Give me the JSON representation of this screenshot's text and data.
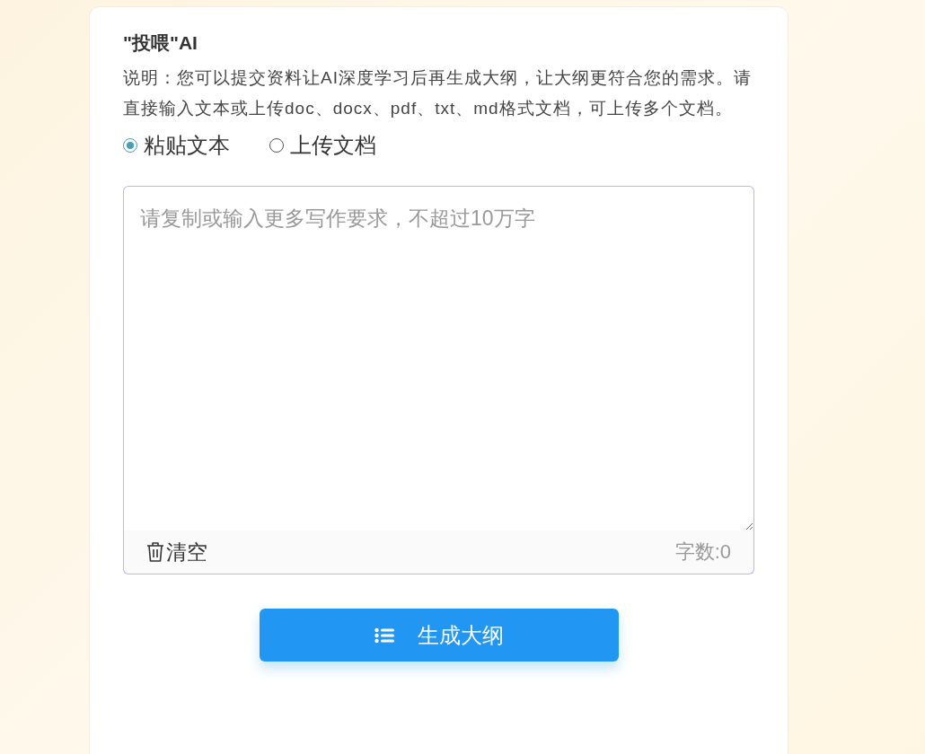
{
  "title": "\"投喂\"AI",
  "description": "说明：您可以提交资料让AI深度学习后再生成大纲，让大纲更符合您的需求。请直接输入文本或上传doc、docx、pdf、txt、md格式文档，可上传多个文档。",
  "modes": [
    {
      "label": "粘贴文本",
      "selected": true
    },
    {
      "label": "上传文档",
      "selected": false
    }
  ],
  "editor": {
    "placeholder": "请复制或输入更多写作要求，不超过10万字",
    "clear_label": "清空",
    "count": "字数:0"
  },
  "submit": {
    "label": "生成大纲"
  }
}
